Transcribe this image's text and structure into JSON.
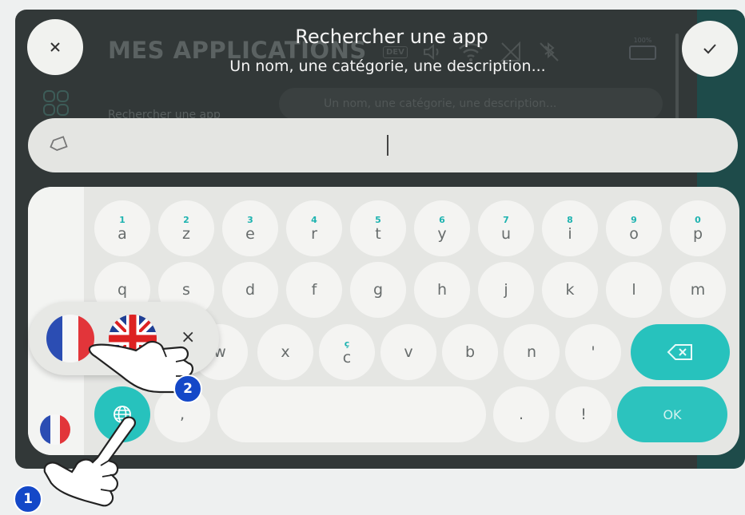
{
  "background": {
    "title": "MES APPLICATIONS",
    "dev_badge": "DEV",
    "battery_label": "100%",
    "search_label": "Rechercher une app",
    "search_placeholder": "Un nom, une catégorie, une description..."
  },
  "header": {
    "title": "Rechercher une app",
    "subtitle": "Un nom, une catégorie, une description...",
    "close_icon": "close-icon",
    "confirm_icon": "check-icon"
  },
  "search": {
    "value": "",
    "clear_icon": "eraser-icon"
  },
  "keyboard": {
    "row1": [
      {
        "num": "1",
        "ch": "a"
      },
      {
        "num": "2",
        "ch": "z"
      },
      {
        "num": "3",
        "ch": "e"
      },
      {
        "num": "4",
        "ch": "r"
      },
      {
        "num": "5",
        "ch": "t"
      },
      {
        "num": "6",
        "ch": "y"
      },
      {
        "num": "7",
        "ch": "u"
      },
      {
        "num": "8",
        "ch": "i"
      },
      {
        "num": "9",
        "ch": "o"
      },
      {
        "num": "0",
        "ch": "p"
      }
    ],
    "row2": [
      "q",
      "s",
      "d",
      "f",
      "g",
      "h",
      "j",
      "k",
      "l",
      "m"
    ],
    "row3": [
      {
        "num": "",
        "ch": "x"
      },
      {
        "num": "ç",
        "ch": "c"
      },
      {
        "num": "",
        "ch": "v"
      },
      {
        "num": "",
        "ch": "b"
      },
      {
        "num": "",
        "ch": "n"
      },
      {
        "num": "",
        "ch": "'"
      }
    ],
    "partial_key": "w",
    "row4": {
      "comma": ",",
      "period": ".",
      "exclaim": "!"
    },
    "ok_label": "OK",
    "backspace_icon": "backspace-icon",
    "globe_icon": "globe-icon"
  },
  "language_popup": {
    "options": [
      "fr-flag-icon",
      "uk-flag-icon"
    ],
    "close": "×"
  },
  "callouts": [
    "1",
    "2"
  ],
  "colors": {
    "accent": "#27c2bd",
    "callout": "#1448c8"
  }
}
